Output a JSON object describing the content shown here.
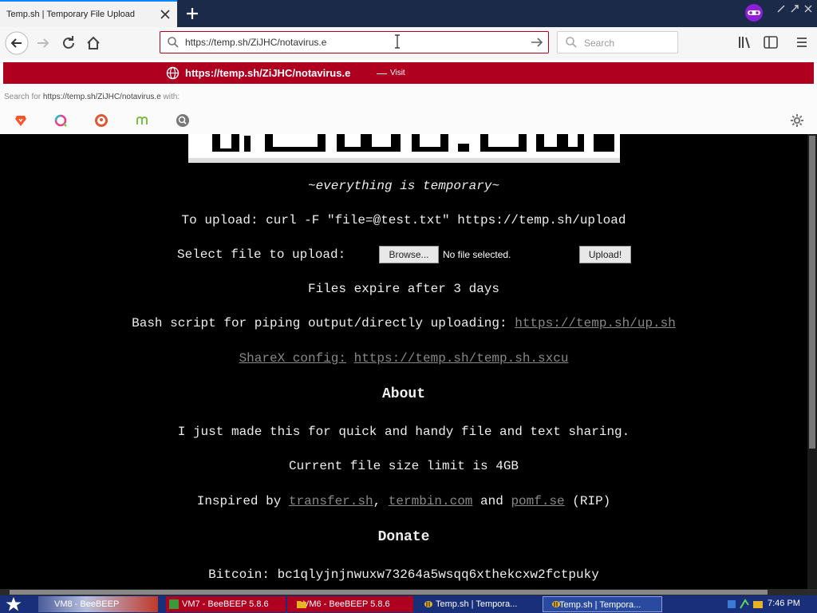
{
  "tab": {
    "title": "Temp.sh | Temporary File Upload"
  },
  "urlbar": {
    "value": "https://temp.sh/ZiJHC/notavirus.e"
  },
  "searchbar": {
    "placeholder": "Search"
  },
  "dropdown": {
    "visit_url": "https://temp.sh/ZiJHC/notavirus.e",
    "visit_dash": "—",
    "visit_label": "Visit",
    "search_for_prefix": "Search for ",
    "search_for_query": "https://temp.sh/ZiJHC/notavirus.e",
    "search_for_suffix": " with:",
    "engines": [
      "brave-icon",
      "qwant-icon",
      "duckduckgo-icon",
      "mojeek-icon",
      "searx-icon"
    ]
  },
  "page": {
    "tagline": "~everything is temporary~",
    "upload_cmd": "To upload: curl -F \"file=@test.txt\" https://temp.sh/upload",
    "select_label": "Select file to upload:",
    "browse_button": "Browse...",
    "no_file": "No file selected.",
    "upload_button": "Upload!",
    "expire": "Files expire after 3 days",
    "bash_label": "Bash script for piping output/directly uploading:",
    "bash_link": "https://temp.sh/up.sh",
    "sharex_label": "ShareX config:",
    "sharex_link": "https://temp.sh/temp.sh.sxcu",
    "about_heading": "About",
    "about_text": "I just made this for quick and handy file and text sharing.",
    "size_limit": "Current file size limit is 4GB",
    "inspired_prefix": "Inspired by",
    "inspired_link1": "transfer.sh",
    "inspired_link2": "termbin.com",
    "inspired_and": "and",
    "inspired_link3": "pomf.se",
    "inspired_suffix": "(RIP)",
    "donate_heading": "Donate",
    "bitcoin": "Bitcoin: bc1qlyjnjnwuxw73264a5wsqq6xthekcxw2fctpuky"
  },
  "taskbar": {
    "items": [
      "VM8 - BeeBEEP",
      "VM7 - BeeBEEP 5.8.6",
      "VM6 - BeeBEEP 5.8.6",
      "Temp.sh | Tempora...",
      "Temp.sh | Tempora..."
    ],
    "clock": "7:46 PM"
  },
  "colors": {
    "accent_red": "#b00020",
    "tab_accent": "#0a84ff",
    "taskbar": "#1a2f7a"
  }
}
